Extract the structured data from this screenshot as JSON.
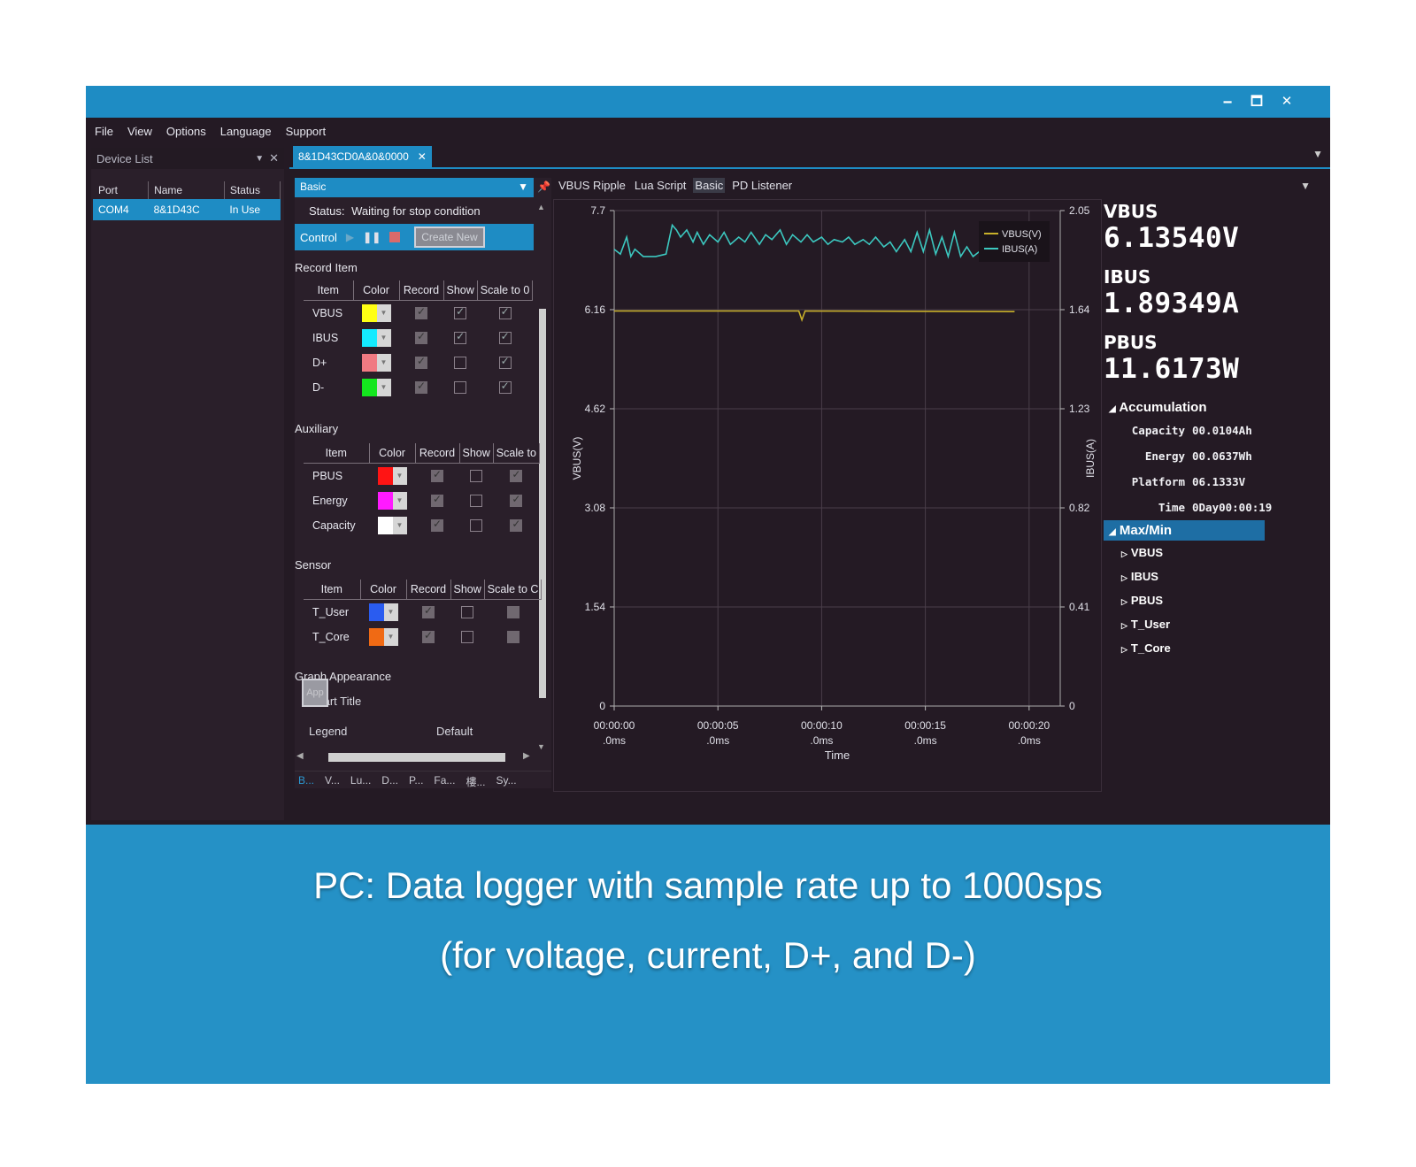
{
  "window": {
    "controls": [
      "🗕",
      "🗖",
      "✕"
    ]
  },
  "menu": [
    "File",
    "View",
    "Options",
    "Language",
    "Support"
  ],
  "device_list": {
    "title": "Device List",
    "columns": [
      "Port",
      "Name",
      "Status"
    ],
    "rows": [
      [
        "COM4",
        "8&1D43C",
        "In Use"
      ]
    ]
  },
  "doc_tab": {
    "label": "8&1D43CD0A&0&0000"
  },
  "config": {
    "select_value": "Basic",
    "status_label": "Status:",
    "status_value": "Waiting for stop condition",
    "control_label": "Control",
    "create_new": "Create New",
    "record_item": {
      "title": "Record Item",
      "columns": [
        "Item",
        "Color",
        "Record",
        "Show",
        "Scale to 0"
      ],
      "rows": [
        {
          "item": "VBUS",
          "color": "#ffff14",
          "record": true,
          "show": true,
          "scale": true
        },
        {
          "item": "IBUS",
          "color": "#14eaff",
          "record": true,
          "show": true,
          "scale": true
        },
        {
          "item": "D+",
          "color": "#f07a82",
          "record": true,
          "show": false,
          "scale": true
        },
        {
          "item": "D-",
          "color": "#14e61e",
          "record": true,
          "show": false,
          "scale": true
        }
      ]
    },
    "auxiliary": {
      "title": "Auxiliary",
      "columns": [
        "Item",
        "Color",
        "Record",
        "Show",
        "Scale to"
      ],
      "rows": [
        {
          "item": "PBUS",
          "color": "#ff1414",
          "record": true,
          "show": false,
          "scale": true
        },
        {
          "item": "Energy",
          "color": "#ff1aff",
          "record": true,
          "show": false,
          "scale": true
        },
        {
          "item": "Capacity",
          "color": "#ffffff",
          "record": true,
          "show": false,
          "scale": true
        }
      ]
    },
    "sensor": {
      "title": "Sensor",
      "columns": [
        "Item",
        "Color",
        "Record",
        "Show",
        "Scale to C"
      ],
      "rows": [
        {
          "item": "T_User",
          "color": "#2a5cf0",
          "record": true,
          "show": false,
          "scale": false
        },
        {
          "item": "T_Core",
          "color": "#f06a14",
          "record": true,
          "show": false,
          "scale": false
        }
      ]
    },
    "graph_appearance": {
      "title": "Graph Appearance",
      "chart_title_label": "Chart Title",
      "legend_label": "Legend",
      "legend_value": "Default",
      "apply": "App"
    },
    "bottom_tabs": [
      "B...",
      "V...",
      "Lu...",
      "D...",
      "P...",
      "Fa...",
      "樓...",
      "Sy..."
    ]
  },
  "chart_tabs": [
    {
      "label": "VBUS Ripple",
      "active": false
    },
    {
      "label": "Lua Script",
      "active": false
    },
    {
      "label": "Basic",
      "active": true
    },
    {
      "label": "PD Listener",
      "active": false
    }
  ],
  "chart_data": {
    "type": "line",
    "xlabel": "Time",
    "ylabel": "VBUS(V)",
    "y2label": "IBUS(A)",
    "x_ticks": [
      {
        "value": 0,
        "line1": "00:00:00",
        "line2": ".0ms"
      },
      {
        "value": 5,
        "line1": "00:00:05",
        "line2": ".0ms"
      },
      {
        "value": 10,
        "line1": "00:00:10",
        "line2": ".0ms"
      },
      {
        "value": 15,
        "line1": "00:00:15",
        "line2": ".0ms"
      },
      {
        "value": 20,
        "line1": "00:00:20",
        "line2": ".0ms"
      }
    ],
    "xlim": [
      0,
      21.5
    ],
    "y_ticks": [
      "0",
      "1.54",
      "3.08",
      "4.62",
      "6.16",
      "7.7"
    ],
    "ylim": [
      0,
      7.7
    ],
    "y2_ticks": [
      "0",
      "0.41",
      "0.82",
      "1.23",
      "1.64",
      "2.05"
    ],
    "y2lim": [
      0,
      2.05
    ],
    "legend": [
      "VBUS(V)",
      "IBUS(A)"
    ],
    "legend_position": "top-right",
    "grid": true,
    "series": [
      {
        "name": "VBUS(V)",
        "color": "#c8b02a",
        "axis": "left",
        "x": [
          0,
          8.9,
          9.05,
          9.2,
          19.3
        ],
        "y": [
          6.14,
          6.14,
          6.0,
          6.14,
          6.13
        ]
      },
      {
        "name": "IBUS(A)",
        "color": "#3cc8c0",
        "axis": "right",
        "x": [
          0,
          0.3,
          0.6,
          0.8,
          1.0,
          1.4,
          2.0,
          2.5,
          2.8,
          3.0,
          3.2,
          3.5,
          3.8,
          4.0,
          4.3,
          4.6,
          5.0,
          5.3,
          5.6,
          6.0,
          6.3,
          6.6,
          7.0,
          7.3,
          7.6,
          8.0,
          8.3,
          8.6,
          9.0,
          9.3,
          9.6,
          10.0,
          10.3,
          10.6,
          11.0,
          11.3,
          11.6,
          12.0,
          12.3,
          12.6,
          13.0,
          13.3,
          13.6,
          14.0,
          14.3,
          14.6,
          14.9,
          15.2,
          15.5,
          15.8,
          16.1,
          16.4,
          16.7,
          17.0,
          17.3,
          17.6,
          18.0,
          18.5,
          19.0,
          19.3
        ],
        "y": [
          1.89,
          1.87,
          1.94,
          1.86,
          1.89,
          1.86,
          1.86,
          1.87,
          1.99,
          1.97,
          1.94,
          1.97,
          1.92,
          1.96,
          1.91,
          1.95,
          1.92,
          1.96,
          1.91,
          1.94,
          1.92,
          1.96,
          1.91,
          1.95,
          1.93,
          1.97,
          1.91,
          1.95,
          1.92,
          1.95,
          1.92,
          1.94,
          1.91,
          1.93,
          1.92,
          1.94,
          1.91,
          1.93,
          1.91,
          1.94,
          1.9,
          1.92,
          1.88,
          1.93,
          1.88,
          1.96,
          1.88,
          1.97,
          1.87,
          1.94,
          1.86,
          1.96,
          1.86,
          1.9,
          1.86,
          1.88,
          1.87,
          1.89,
          1.88,
          1.89
        ]
      }
    ]
  },
  "readout": {
    "vbus_label": "VBUS",
    "vbus_value": "6.13540V",
    "ibus_label": "IBUS",
    "ibus_value": "1.89349A",
    "pbus_label": "PBUS",
    "pbus_value": "11.6173W",
    "accumulation_label": "Accumulation",
    "accumulation": [
      {
        "key": "Capacity",
        "value": "00.0104Ah"
      },
      {
        "key": "Energy",
        "value": "00.0637Wh"
      },
      {
        "key": "Platform",
        "value": "06.1333V"
      },
      {
        "key": "Time",
        "value": "0Day00:00:19"
      }
    ],
    "maxmin_label": "Max/Min",
    "maxmin_items": [
      "VBUS",
      "IBUS",
      "PBUS",
      "T_User",
      "T_Core"
    ]
  },
  "caption": {
    "line1": "PC: Data logger with sample rate up to 1000sps",
    "line2": "(for voltage, current, D+, and D-)"
  }
}
